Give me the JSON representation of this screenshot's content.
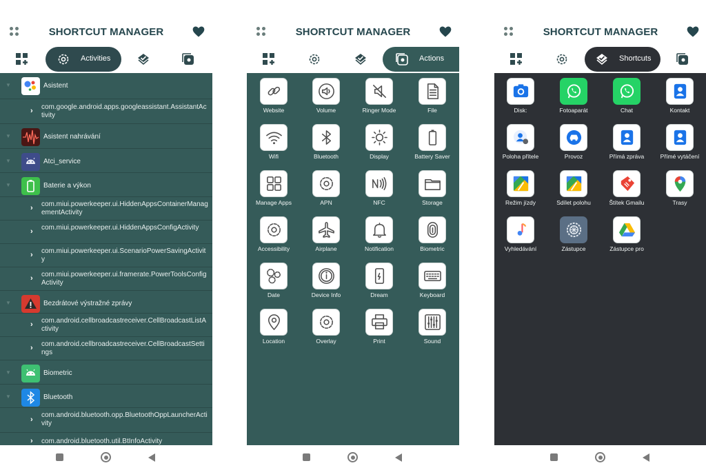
{
  "colors": {
    "accent": "#25464d",
    "activities_bg": "#355b59",
    "shortcuts_bg": "#2d3035"
  },
  "common": {
    "app_title": "SHORTCUT MANAGER"
  },
  "screens": [
    {
      "active_tab": "Activities"
    },
    {
      "active_tab": "Actions"
    },
    {
      "active_tab": "Shortcuts"
    }
  ],
  "activities": [
    {
      "name": "Asistent",
      "icon": "google-assistant-icon",
      "children": [
        "com.google.android.apps.googleassistant.AssistantActivity"
      ]
    },
    {
      "name": "Asistent nahrávání",
      "icon": "voice-recorder-icon",
      "children": []
    },
    {
      "name": "Atci_service",
      "icon": "android-icon",
      "children": []
    },
    {
      "name": "Baterie a výkon",
      "icon": "battery-icon",
      "children": [
        "com.miui.powerkeeper.ui.HiddenAppsContainerManagementActivity",
        "com.miui.powerkeeper.ui.HiddenAppsConfigActivity",
        "com.miui.powerkeeper.ui.ScenarioPowerSavingActivity",
        "com.miui.powerkeeper.ui.framerate.PowerToolsConfigActivity"
      ]
    },
    {
      "name": "Bezdrátové výstražné zprávy",
      "icon": "warning-icon",
      "children": [
        "com.android.cellbroadcastreceiver.CellBroadcastListActivity",
        "com.android.cellbroadcastreceiver.CellBroadcastSettings"
      ]
    },
    {
      "name": "Biometric",
      "icon": "android-icon",
      "children": []
    },
    {
      "name": "Bluetooth",
      "icon": "bluetooth-icon",
      "children": [
        "com.android.bluetooth.opp.BluetoothOppLauncherActivity",
        "com.android.bluetooth.util.BtInfoActivity"
      ]
    }
  ],
  "actions": [
    {
      "label": "Website",
      "icon": "link-icon"
    },
    {
      "label": "Volume",
      "icon": "volume-icon"
    },
    {
      "label": "Ringer Mode",
      "icon": "ringer-mute-icon"
    },
    {
      "label": "File",
      "icon": "file-icon"
    },
    {
      "label": "Wifi",
      "icon": "wifi-icon"
    },
    {
      "label": "Bluetooth",
      "icon": "bluetooth-icon"
    },
    {
      "label": "Display",
      "icon": "sun-icon"
    },
    {
      "label": "Battery Saver",
      "icon": "battery-icon"
    },
    {
      "label": "Manage Apps",
      "icon": "apps-grid-icon"
    },
    {
      "label": "APN",
      "icon": "gear-icon"
    },
    {
      "label": "NFC",
      "icon": "nfc-icon"
    },
    {
      "label": "Storage",
      "icon": "folder-icon"
    },
    {
      "label": "Accessibility",
      "icon": "gear-icon"
    },
    {
      "label": "Airplane",
      "icon": "airplane-icon"
    },
    {
      "label": "Notification",
      "icon": "bell-icon"
    },
    {
      "label": "Biometric",
      "icon": "fingerprint-icon"
    },
    {
      "label": "Date",
      "icon": "gears-icon"
    },
    {
      "label": "Device Info",
      "icon": "info-icon"
    },
    {
      "label": "Dream",
      "icon": "phone-icon"
    },
    {
      "label": "Keyboard",
      "icon": "keyboard-icon"
    },
    {
      "label": "Location",
      "icon": "location-pin-icon"
    },
    {
      "label": "Overlay",
      "icon": "gear-icon"
    },
    {
      "label": "Print",
      "icon": "printer-icon"
    },
    {
      "label": "Sound",
      "icon": "equalizer-icon"
    }
  ],
  "shortcuts": [
    {
      "label": "Disk:",
      "icon": "camera-icon"
    },
    {
      "label": "Fotoaparát",
      "icon": "whatsapp-icon"
    },
    {
      "label": "Chat",
      "icon": "whatsapp-icon"
    },
    {
      "label": "Kontakt",
      "icon": "contact-icon"
    },
    {
      "label": "Poloha přítele",
      "icon": "contact-location-icon"
    },
    {
      "label": "Provoz",
      "icon": "car-icon"
    },
    {
      "label": "Přímá zpráva",
      "icon": "contact-icon"
    },
    {
      "label": "Přímé vytáčení",
      "icon": "contact-icon"
    },
    {
      "label": "Režim jízdy",
      "icon": "maps-icon"
    },
    {
      "label": "Sdílet polohu",
      "icon": "maps-icon"
    },
    {
      "label": "Štítek Gmailu",
      "icon": "gmail-label-icon"
    },
    {
      "label": "Trasy",
      "icon": "maps-pin-icon"
    },
    {
      "label": "Vyhledávání",
      "icon": "music-icon"
    },
    {
      "label": "Zástupce",
      "icon": "settings-icon"
    },
    {
      "label": "Zástupce pro",
      "icon": "drive-icon"
    }
  ]
}
